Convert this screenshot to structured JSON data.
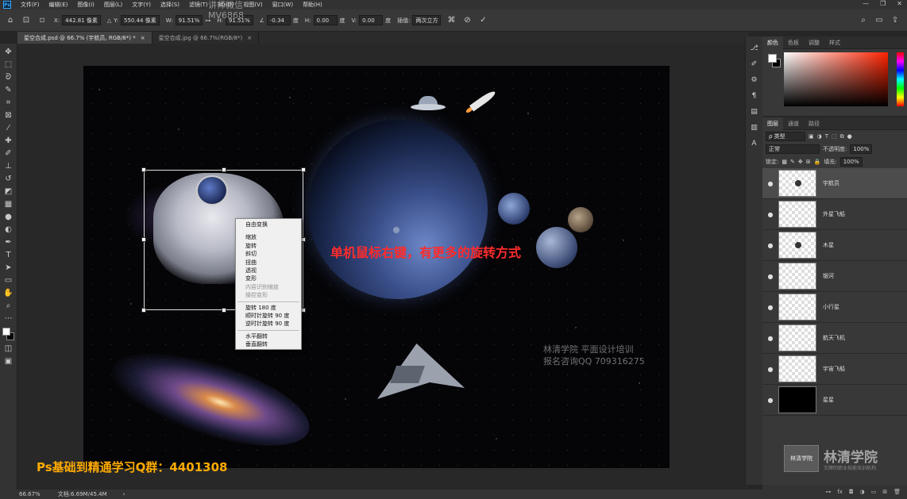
{
  "app": {
    "logo": "Ps",
    "window_controls": [
      "—",
      "❐",
      "✕"
    ]
  },
  "menu": [
    "文件(F)",
    "编辑(E)",
    "图像(I)",
    "图层(L)",
    "文字(Y)",
    "选择(S)",
    "滤镜(T)",
    "3D(D)",
    "视图(V)",
    "窗口(W)",
    "帮助(H)"
  ],
  "overlay_watermark": {
    "line1": "讲师微信",
    "line2": "MV6868"
  },
  "options": {
    "x_label": "X:",
    "x_value": "442.81 像素",
    "y_label": "Y:",
    "y_value": "550.44 像素",
    "w_label": "W:",
    "w_value": "91.51%",
    "h_label": "H:",
    "h_value": "91.51%",
    "angle_value": "-0.34",
    "angle_unit": "度",
    "hskew_label": "H:",
    "hskew_value": "0.00",
    "hskew_unit": "度",
    "vskew_label": "V:",
    "vskew_value": "0.00",
    "vskew_unit": "度",
    "interp_label": "插值:",
    "interp_value": "两次立方"
  },
  "tabs": [
    {
      "label": "星空合成.psd @ 66.7% (宇航员, RGB/8*) *",
      "close": "×"
    },
    {
      "label": "星空合成.jpg @ 66.7%(RGB/8*)",
      "close": "×"
    }
  ],
  "context_menu": {
    "free_transform": "自由变换",
    "group1": [
      "缩放",
      "旋转",
      "斜切",
      "扭曲",
      "透视",
      "变形"
    ],
    "group1_disabled": [
      "内容识别缩放",
      "操控变形"
    ],
    "group2": [
      "旋转 180 度",
      "顺时针旋转 90 度",
      "逆时针旋转 90 度"
    ],
    "group3": [
      "水平翻转",
      "垂直翻转"
    ]
  },
  "annotation": "单机鼠标右键，有更多的旋转方式",
  "canvas_watermark": {
    "line1": "林清学院  平面设计培训",
    "line2": "报名咨询QQ 709316275"
  },
  "qq_group": "Ps基础到精通学习Q群：4401308",
  "status": {
    "zoom": "66.67%",
    "doc": "文档:6.69M/45.4M",
    "arrow": "›"
  },
  "color_panel": {
    "tabs": [
      "颜色",
      "色板",
      "调整",
      "样式"
    ]
  },
  "layers_panel": {
    "tabs": [
      "图层",
      "通道",
      "路径"
    ],
    "filter": "ρ 类型",
    "blend": "正常",
    "opacity_label": "不透明度:",
    "opacity_value": "100%",
    "lock_label": "锁定:",
    "fill_label": "填充:",
    "fill_value": "100%",
    "layers": [
      {
        "name": "宇航员"
      },
      {
        "name": "外星飞船"
      },
      {
        "name": "木星"
      },
      {
        "name": "银河"
      },
      {
        "name": "小行星"
      },
      {
        "name": "航天飞机"
      },
      {
        "name": "宇宙飞船"
      },
      {
        "name": "星星"
      }
    ]
  },
  "brand": {
    "logo_box": "林清学院",
    "name": "林清学院",
    "sub": "王牌的职业技能培训机构"
  },
  "colors": {
    "accent_annotation": "#ff2b2b",
    "qq_group": "#ffab00",
    "selected_layer": "#4c4c4c"
  }
}
